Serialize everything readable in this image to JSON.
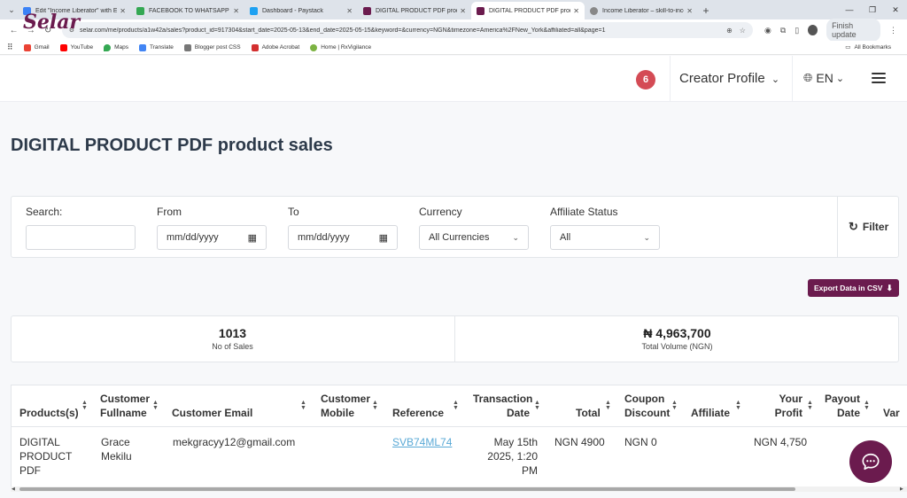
{
  "browser": {
    "tabs": [
      {
        "title": "Edit \"Income Liberator\" with Ele",
        "color": "#3b82f6",
        "active": false
      },
      {
        "title": "FACEBOOK TO WHATSAPP ADS",
        "color": "#34a853",
        "active": false
      },
      {
        "title": "Dashboard - Paystack",
        "color": "#1da1f2",
        "active": false
      },
      {
        "title": "DIGITAL PRODUCT PDF product",
        "color": "#6b1b4e",
        "active": false
      },
      {
        "title": "DIGITAL PRODUCT PDF produ",
        "color": "#6b1b4e",
        "active": true
      },
      {
        "title": "Income Liberator – skill-to-inco",
        "color": "#888888",
        "active": false
      }
    ],
    "url": "selar.com/me/products/a1w42a/sales?product_id=917304&start_date=2025-05-13&end_date=2025-05-15&keyword=&currency=NGN&timezone=America%2FNew_York&affiliated=all&page=1",
    "finish_update": "Finish update",
    "profile_initial": "A",
    "bookmarks": [
      {
        "label": "Gmail",
        "color": "#ea4335"
      },
      {
        "label": "YouTube",
        "color": "#ff0000"
      },
      {
        "label": "Maps",
        "color": "#34a853"
      },
      {
        "label": "Translate",
        "color": "#4285f4"
      },
      {
        "label": "Blogger post CSS",
        "color": "#777777"
      },
      {
        "label": "Adobe Acrobat",
        "color": "#d32f2f"
      },
      {
        "label": "Home | RxVigilance",
        "color": "#7cb342"
      }
    ],
    "all_bookmarks": "All Bookmarks"
  },
  "header": {
    "logo": "Selar",
    "notification_count": "6",
    "creator_profile": "Creator Profile",
    "language": "EN"
  },
  "page": {
    "title": "DIGITAL PRODUCT PDF product sales"
  },
  "filters": {
    "search_label": "Search:",
    "search_value": "",
    "from_label": "From",
    "from_placeholder": "mm/dd/yyyy",
    "to_label": "To",
    "to_placeholder": "mm/dd/yyyy",
    "currency_label": "Currency",
    "currency_value": "All Currencies",
    "affiliate_label": "Affiliate Status",
    "affiliate_value": "All",
    "filter_button": "Filter"
  },
  "export": {
    "label": "Export Data in CSV"
  },
  "stats": {
    "sales_value": "1013",
    "sales_label": "No of Sales",
    "volume_value": "₦ 4,963,700",
    "volume_label": "Total Volume (NGN)"
  },
  "table": {
    "headers": {
      "products": "Products(s)",
      "customer_fullname": [
        "Customer",
        "Fullname"
      ],
      "customer_email": "Customer Email",
      "customer_mobile": [
        "Customer",
        "Mobile"
      ],
      "reference": "Reference",
      "transaction_date": [
        "Transaction",
        "Date"
      ],
      "total": "Total",
      "coupon_discount": [
        "Coupon",
        "Discount"
      ],
      "affiliate": "Affiliate",
      "your_profit": [
        "Your",
        "Profit"
      ],
      "payout_date": [
        "Payout",
        "Date"
      ],
      "variant": "Var"
    },
    "rows": [
      {
        "product": [
          "DIGITAL",
          "PRODUCT",
          "PDF"
        ],
        "fullname": [
          "Grace",
          "Mekilu"
        ],
        "email": "mekgracyy12@gmail.com",
        "mobile": "",
        "reference": "SVB74ML74",
        "date": [
          "May 15th",
          "2025, 1:20",
          "PM"
        ],
        "total": "NGN 4900",
        "coupon": "NGN 0",
        "affiliate": "",
        "profit": "NGN 4,750",
        "payout_date": ""
      }
    ]
  }
}
